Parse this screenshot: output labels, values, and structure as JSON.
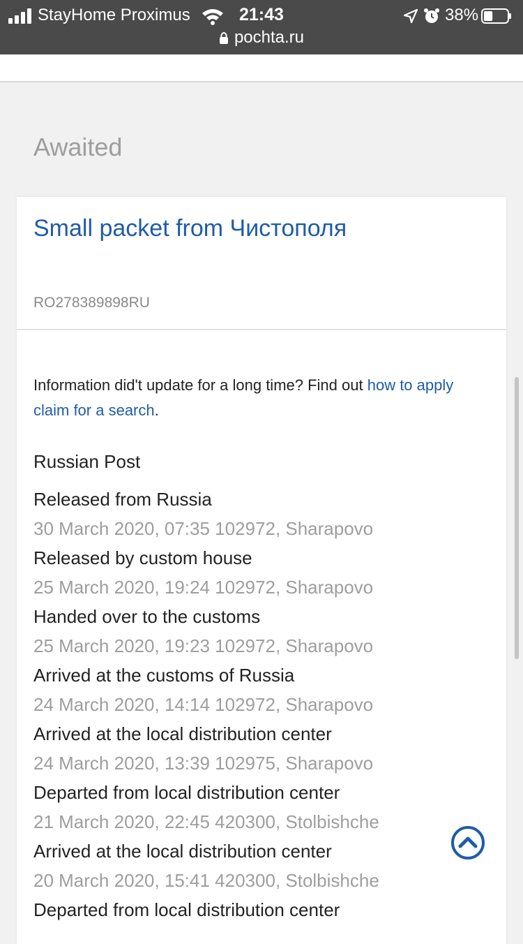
{
  "status_bar": {
    "carrier": "StayHome Proximus",
    "time": "21:43",
    "battery_percent": "38%",
    "battery_level": 0.38
  },
  "browser": {
    "url": "pochta.ru"
  },
  "section": {
    "heading": "Awaited"
  },
  "parcel": {
    "title": "Small packet from Чистополя",
    "tracking_number": "RO278389898RU",
    "info_prefix": "Information did't update for a long time? Find out ",
    "info_link": "how to apply claim for a search",
    "info_suffix": ".",
    "operator": "Russian Post",
    "events": [
      {
        "status": "Released from Russia",
        "meta": "30 March 2020, 07:35 102972, Sharapovo"
      },
      {
        "status": "Released by custom house",
        "meta": "25 March 2020, 19:24 102972, Sharapovo"
      },
      {
        "status": "Handed over to the customs",
        "meta": "25 March 2020, 19:23 102972, Sharapovo"
      },
      {
        "status": "Arrived at the customs of Russia",
        "meta": "24 March 2020, 14:14 102972, Sharapovo"
      },
      {
        "status": "Arrived at the local distribution center",
        "meta": "24 March 2020, 13:39 102975, Sharapovo"
      },
      {
        "status": "Departed from local distribution center",
        "meta": "21 March 2020, 22:45 420300, Stolbishche"
      },
      {
        "status": "Arrived at the local distribution center",
        "meta": "20 March 2020, 15:41 420300, Stolbishche"
      },
      {
        "status": "Departed from local distribution center",
        "meta": ""
      }
    ]
  },
  "icons": {
    "scroll_to_top": "chevron-up-circle-icon",
    "lock": "lock-icon",
    "wifi": "wifi-icon",
    "location": "location-arrow-icon",
    "alarm": "alarm-icon"
  },
  "colors": {
    "link": "#1f5ca8",
    "muted": "#9e9e9e",
    "background": "#f1f1f1",
    "status_bar": "#4a4a4a"
  }
}
